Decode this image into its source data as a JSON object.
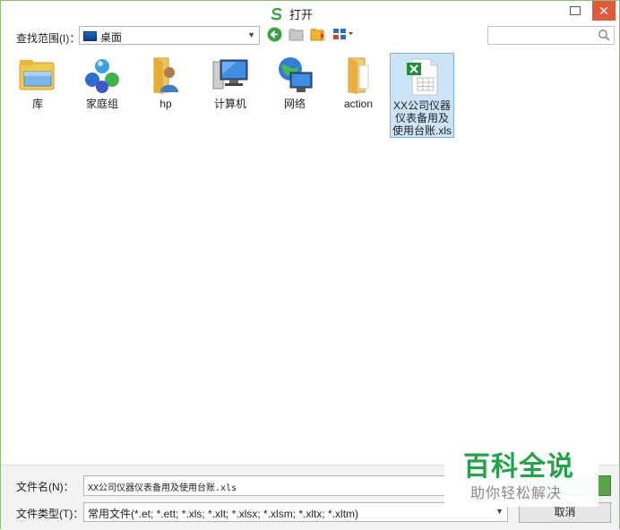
{
  "window": {
    "title": "打开",
    "close_glyph": "✕"
  },
  "toolbar": {
    "lookin_label": "查找范围(I)：",
    "lookin_value": "桌面",
    "search_placeholder": ""
  },
  "files": [
    {
      "label": "库",
      "icon": "library-icon"
    },
    {
      "label": "家庭组",
      "icon": "homegroup-icon"
    },
    {
      "label": "hp",
      "icon": "user-folder-icon"
    },
    {
      "label": "计算机",
      "icon": "computer-icon"
    },
    {
      "label": "网络",
      "icon": "network-icon"
    },
    {
      "label": "action",
      "icon": "folder-icon"
    },
    {
      "label": "XX公司仪器仪表备用及使用台账.xls",
      "icon": "excel-file-icon",
      "selected": true
    }
  ],
  "bottom": {
    "filename_label": "文件名(N)：",
    "filename_value": "XX公司仪器仪表备用及使用台账.xls",
    "filetype_label": "文件类型(T)：",
    "filetype_value": "常用文件(*.et; *.ett; *.xls; *.xlt; *.xlsx; *.xlsm; *.xltx; *.xltm)",
    "open_label": "",
    "cancel_label": "取消"
  },
  "watermark": {
    "title": "百科全说",
    "subtitle": "助你轻松解决"
  },
  "colors": {
    "accent": "#5aa34a",
    "selection": "#cce4f7",
    "close": "#e05a3a",
    "watermark": "#23a347"
  }
}
